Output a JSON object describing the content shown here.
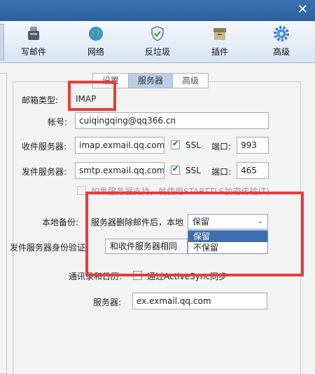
{
  "window": {
    "close_glyph": "✕"
  },
  "toolbar": {
    "items": [
      {
        "label": "写邮件",
        "icon": "compose-icon"
      },
      {
        "label": "网络",
        "icon": "globe-icon"
      },
      {
        "label": "反垃圾",
        "icon": "shield-icon"
      },
      {
        "label": "插件",
        "icon": "plugin-box-icon"
      },
      {
        "label": "高级",
        "icon": "gear-icon"
      }
    ]
  },
  "tabs": [
    {
      "label": "设置",
      "active": false
    },
    {
      "label": "服务器",
      "active": true
    },
    {
      "label": "高级",
      "active": false
    }
  ],
  "form": {
    "mailbox_type_label": "邮箱类型:",
    "mailbox_type_value": "IMAP",
    "account_label": "帐号:",
    "account_value": "cuiqingqing@qq366.cn",
    "incoming_label": "收件服务器:",
    "incoming_value": "imap.exmail.qq.com",
    "incoming_ssl_label": "SSL",
    "incoming_port_label": "端口:",
    "incoming_port_value": "993",
    "outgoing_label": "发件服务器:",
    "outgoing_value": "smtp.exmail.qq.com",
    "outgoing_ssl_label": "SSL",
    "outgoing_port_label": "端口:",
    "outgoing_port_value": "465",
    "starttls_label": "如果服务器支持，就使用STARTTLS加密传输(T)",
    "local_backup_label": "本地备份:",
    "local_backup_desc": "服务器删除邮件后，本地",
    "local_backup_selected": "保留",
    "local_backup_options": [
      "保留",
      "不保留"
    ],
    "smtp_auth_label": "发件服务器身份验证:",
    "smtp_auth_value": "和收件服务器相同",
    "sync_label": "通讯录和日历:",
    "sync_option_label": "通过ActiveSync同步",
    "sync_server_label": "服务器:",
    "sync_server_value": "ex.exmail.qq.com"
  },
  "colors": {
    "highlight": "#ea3b3b",
    "title_bar": "#2f66a8",
    "selected_option": "#3d6fb0"
  }
}
